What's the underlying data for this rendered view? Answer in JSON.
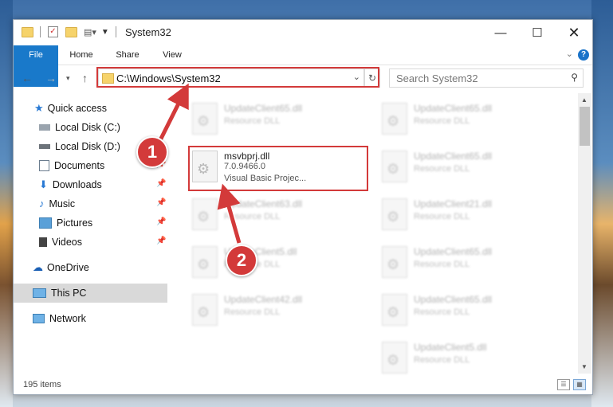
{
  "window": {
    "title": "System32",
    "ribbon_tabs": [
      "File",
      "Home",
      "Share",
      "View"
    ]
  },
  "address": {
    "path": "C:\\Windows\\System32"
  },
  "search": {
    "placeholder": "Search System32"
  },
  "nav": {
    "quick_access": "Quick access",
    "items": [
      {
        "label": "Local Disk (C:)",
        "icon": "drive-icon"
      },
      {
        "label": "Local Disk (D:)",
        "icon": "drive-icon"
      },
      {
        "label": "Documents",
        "icon": "documents-icon"
      },
      {
        "label": "Downloads",
        "icon": "download-icon"
      },
      {
        "label": "Music",
        "icon": "music-icon"
      },
      {
        "label": "Pictures",
        "icon": "pictures-icon"
      },
      {
        "label": "Videos",
        "icon": "videos-icon"
      }
    ],
    "onedrive": "OneDrive",
    "this_pc": "This PC",
    "network": "Network"
  },
  "files": {
    "left": [
      {
        "name": "UpdateClient65.dll",
        "type": "Resource DLL"
      },
      {
        "name": "UpdateClient63.dll",
        "type": "Resource DLL"
      },
      {
        "name": "UpdateClient5.dll",
        "type": "Resource DLL"
      },
      {
        "name": "UpdateClient42.dll",
        "type": "Resource DLL"
      }
    ],
    "right": [
      {
        "name": "UpdateClient65.dll",
        "type": "Resource DLL"
      },
      {
        "name": "UpdateClient65.dll",
        "type": "Resource DLL"
      },
      {
        "name": "UpdateClient21.dll",
        "type": "Resource DLL"
      },
      {
        "name": "UpdateClient65.dll",
        "type": "Resource DLL"
      },
      {
        "name": "UpdateClient65.dll",
        "type": "Resource DLL"
      },
      {
        "name": "UpdateClient5.dll",
        "type": "Resource DLL"
      }
    ],
    "highlighted": {
      "name": "msvbprj.dll",
      "version": "7.0.9466.0",
      "description": "Visual Basic Projec..."
    }
  },
  "status": {
    "items": "195 items"
  },
  "annotations": {
    "step1": "1",
    "step2": "2",
    "color": "#d33a3a"
  }
}
